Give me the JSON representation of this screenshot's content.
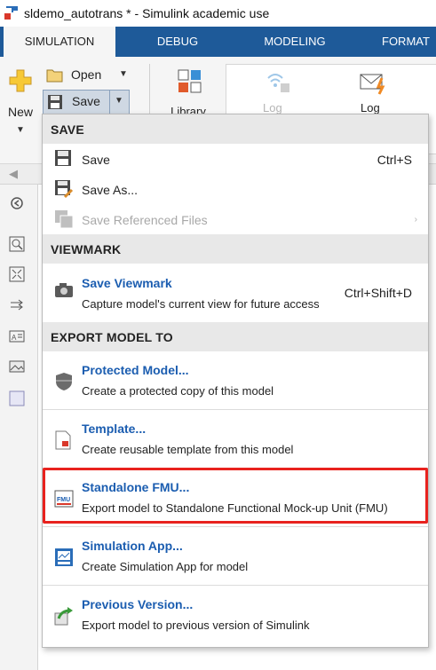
{
  "window": {
    "title": "sldemo_autotrans * - Simulink academic use"
  },
  "tabs": [
    {
      "label": "SIMULATION",
      "active": true
    },
    {
      "label": "DEBUG"
    },
    {
      "label": "MODELING"
    },
    {
      "label": "FORMAT"
    }
  ],
  "toolstrip": {
    "new_label": "New",
    "open_label": "Open",
    "save_label": "Save",
    "library_label": "Library",
    "log1_label": "Log",
    "log2_label": "Log"
  },
  "menu": {
    "sections": {
      "save": "SAVE",
      "viewmark": "VIEWMARK",
      "export": "EXPORT MODEL TO"
    },
    "save_items": [
      {
        "label": "Save",
        "shortcut": "Ctrl+S"
      },
      {
        "label": "Save As..."
      },
      {
        "label": "Save Referenced Files",
        "disabled": true
      }
    ],
    "viewmark_item": {
      "title": "Save Viewmark",
      "description": "Capture model's current view for future access",
      "shortcut": "Ctrl+Shift+D"
    },
    "export_items": [
      {
        "title": "Protected Model...",
        "description": "Create a protected copy of this model"
      },
      {
        "title": "Template...",
        "description": "Create reusable template from this model"
      },
      {
        "title": "Standalone FMU...",
        "description": "Export model to Standalone Functional Mock-up Unit (FMU)",
        "highlighted": true
      },
      {
        "title": "Simulation App...",
        "description": "Create Simulation App for model"
      },
      {
        "title": "Previous Version...",
        "description": "Export model to previous version of Simulink"
      }
    ]
  },
  "colors": {
    "tab_strip": "#1e5a99",
    "link_blue": "#1b5db0",
    "highlight_red": "#e8221e"
  }
}
